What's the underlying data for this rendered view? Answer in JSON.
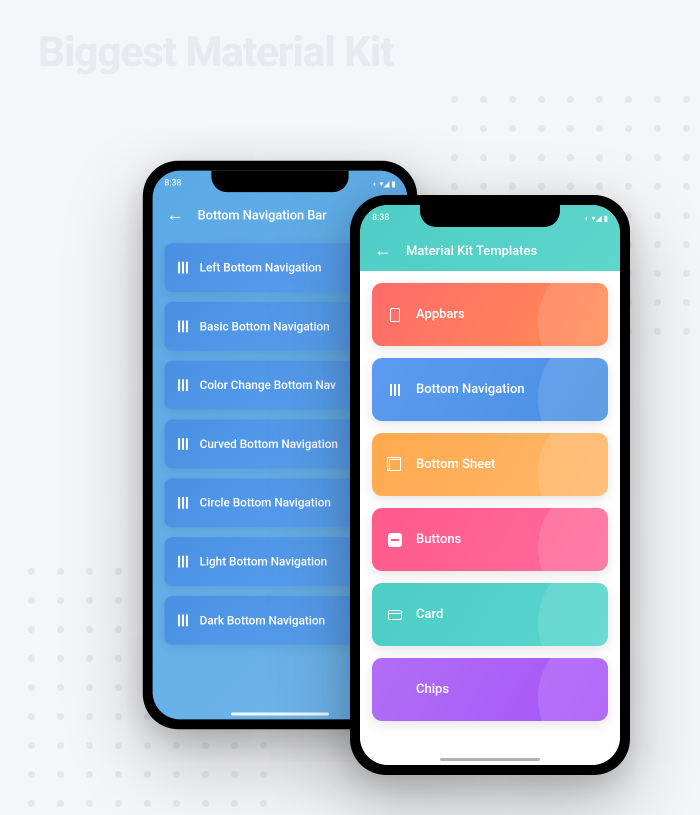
{
  "hero": {
    "title": "Biggest Material Kit"
  },
  "phone_back": {
    "status_time": "8:38",
    "app_bar_title": "Bottom Navigation Bar",
    "items": [
      {
        "label": "Left Bottom Navigation"
      },
      {
        "label": "Basic Bottom Navigation"
      },
      {
        "label": "Color Change Bottom Nav"
      },
      {
        "label": "Curved Bottom Navigation"
      },
      {
        "label": "Circle Bottom Navigation"
      },
      {
        "label": "Light Bottom Navigation"
      },
      {
        "label": "Dark Bottom Navigation"
      }
    ]
  },
  "phone_front": {
    "status_time": "8:38",
    "app_bar_title": "Material Kit Templates",
    "items": [
      {
        "label": "Appbars",
        "gradient": "grad-red",
        "icon": "appbar"
      },
      {
        "label": "Bottom Navigation",
        "gradient": "grad-blue",
        "icon": "bars"
      },
      {
        "label": "Bottom Sheet",
        "gradient": "grad-orange",
        "icon": "sheet"
      },
      {
        "label": "Buttons",
        "gradient": "grad-pink",
        "icon": "minus"
      },
      {
        "label": "Card",
        "gradient": "grad-teal",
        "icon": "card"
      },
      {
        "label": "Chips",
        "gradient": "grad-purple",
        "icon": "chip"
      }
    ]
  }
}
